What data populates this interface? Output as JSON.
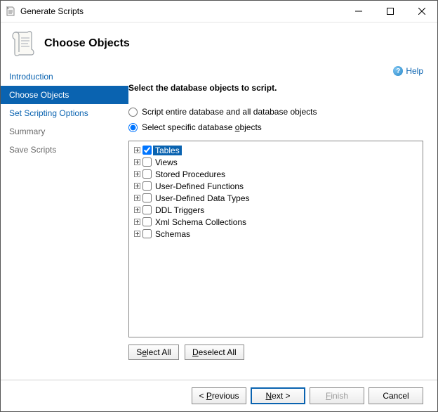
{
  "window": {
    "title": "Generate Scripts"
  },
  "header": {
    "title": "Choose Objects"
  },
  "sidebar": {
    "items": [
      {
        "label": "Introduction",
        "state": "link"
      },
      {
        "label": "Choose Objects",
        "state": "selected"
      },
      {
        "label": "Set Scripting Options",
        "state": "link"
      },
      {
        "label": "Summary",
        "state": "muted"
      },
      {
        "label": "Save Scripts",
        "state": "muted"
      }
    ]
  },
  "help": {
    "label": "Help"
  },
  "content": {
    "heading": "Select the database objects to script.",
    "radio_all": "Script entire database and all database objects",
    "radio_specific_before": "Select specific database ",
    "radio_specific_underlined": "o",
    "radio_specific_after": "bjects",
    "selected_radio": "specific"
  },
  "tree": [
    {
      "label": "Tables",
      "checked": true,
      "highlight": true
    },
    {
      "label": "Views",
      "checked": false
    },
    {
      "label": "Stored Procedures",
      "checked": false
    },
    {
      "label": "User-Defined Functions",
      "checked": false
    },
    {
      "label": "User-Defined Data Types",
      "checked": false
    },
    {
      "label": "DDL Triggers",
      "checked": false
    },
    {
      "label": "Xml Schema Collections",
      "checked": false
    },
    {
      "label": "Schemas",
      "checked": false
    }
  ],
  "buttons": {
    "select_all_before": "S",
    "select_all_underlined": "e",
    "select_all_after": "lect All",
    "deselect_all_underlined": "D",
    "deselect_all_after": "eselect All",
    "previous": "< ",
    "previous_underlined": "P",
    "previous_after": "revious",
    "next_underlined": "N",
    "next_after": "ext >",
    "finish_underlined": "F",
    "finish_after": "inish",
    "cancel": "Cancel"
  }
}
